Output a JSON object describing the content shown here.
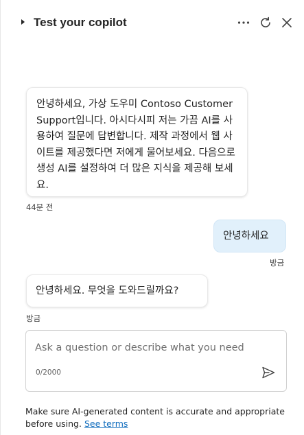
{
  "header": {
    "title": "Test your copilot",
    "icons": [
      "chevron-right-icon",
      "more-icon",
      "refresh-icon",
      "close-icon"
    ]
  },
  "messages": [
    {
      "role": "bot",
      "text": "안녕하세요, 가상 도우미 Contoso Customer Support입니다. 아시다시피 저는 가끔 AI를 사용하여 질문에 답변합니다. 제작 과정에서 웹 사이트를 제공했다면 저에게 물어보세요. 다음으로 생성 AI를 설정하여 더 많은 지식을 제공해 보세요.",
      "timestamp": "44분 전"
    },
    {
      "role": "user",
      "text": "안녕하세요",
      "timestamp": "방금"
    },
    {
      "role": "bot",
      "text": "안녕하세요. 무엇을 도와드릴까요?",
      "timestamp": "방금"
    }
  ],
  "composer": {
    "placeholder": "Ask a question or describe what you need",
    "value": "",
    "counter": "0/2000"
  },
  "footer": {
    "disclaimer": "Make sure AI-generated content is accurate and appropriate before using.",
    "link": "See terms"
  },
  "colors": {
    "user_bubble": "#e1f0fb",
    "link": "#0f6cbd",
    "text": "#242424"
  }
}
